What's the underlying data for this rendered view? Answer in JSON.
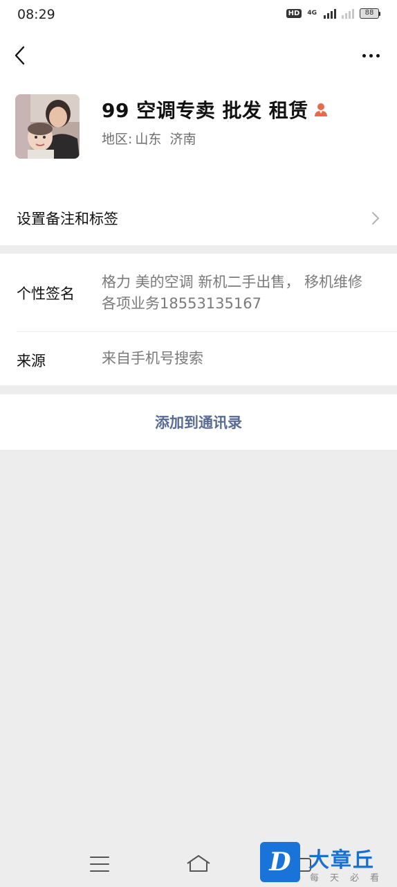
{
  "status_bar": {
    "time": "08:29",
    "hd_badge": "HD",
    "network_label": "4G",
    "battery_level": "88"
  },
  "nav": {
    "back_icon": "chevron-left-icon",
    "more_icon": "more-icon"
  },
  "profile": {
    "name": "99 空调专卖 批发 租赁",
    "gender_icon": "female-icon",
    "gender_color": "#e86a4a",
    "region_label": "地区:",
    "region_value": "山东  济南"
  },
  "remark": {
    "label": "设置备注和标签"
  },
  "info": {
    "signature_label": "个性签名",
    "signature_value": "格力 美的空调 新机二手出售， 移机维修 各项业务18553135167",
    "source_label": "来源",
    "source_value": "来自手机号搜索"
  },
  "actions": {
    "add_contact_label": "添加到通讯录",
    "link_color": "#576b95"
  },
  "system_nav": {
    "menu_icon": "menu-icon",
    "home_icon": "home-icon",
    "recent_icon": "recent-apps-icon"
  },
  "watermark": {
    "logo_letter": "D",
    "title": "大章丘",
    "subtitle": "每天必看"
  }
}
